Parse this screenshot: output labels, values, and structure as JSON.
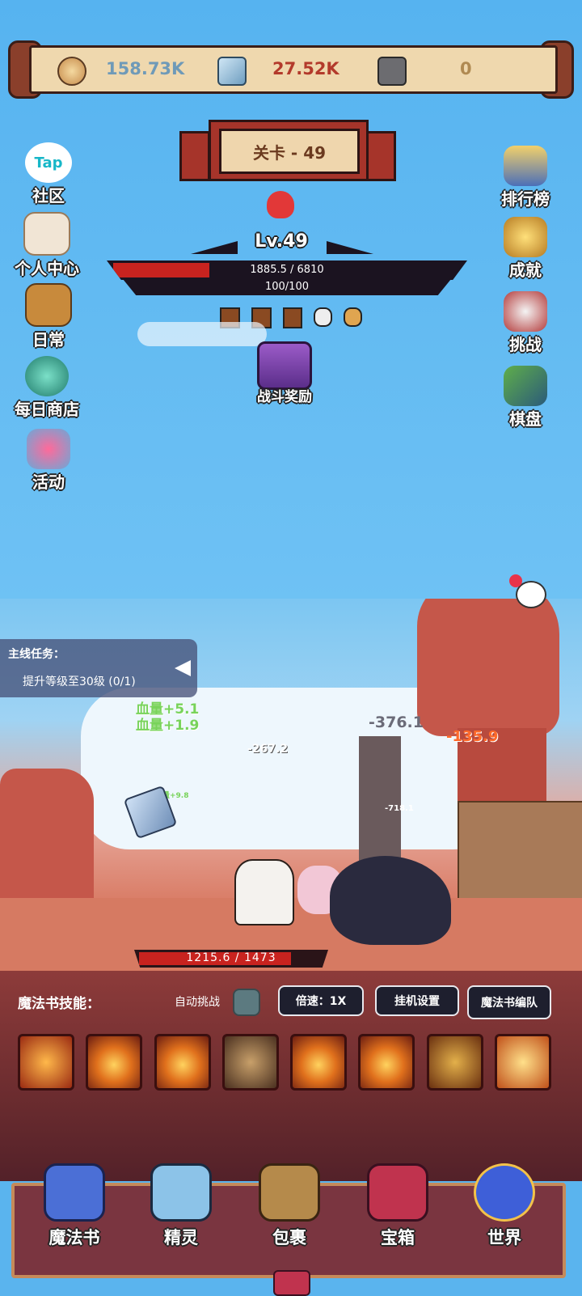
{
  "resources": {
    "gold": "158.73K",
    "crystal": "27.52K",
    "rune": "0"
  },
  "stage": {
    "label": "关卡 - 49"
  },
  "left_menu": [
    {
      "label": "社区",
      "icon": "tap-community-icon",
      "badge": "Tap"
    },
    {
      "label": "个人中心",
      "icon": "scroll-profile-icon"
    },
    {
      "label": "日常",
      "icon": "bucket-daily-icon"
    },
    {
      "label": "每日商店",
      "icon": "crystal-ball-shop-icon"
    },
    {
      "label": "活动",
      "icon": "potion-event-icon"
    }
  ],
  "right_menu": [
    {
      "label": "排行榜",
      "icon": "sword-ranking-icon"
    },
    {
      "label": "成就",
      "icon": "trophy-icon"
    },
    {
      "label": "挑战",
      "icon": "skull-challenge-icon"
    },
    {
      "label": "棋盘",
      "icon": "board-icon"
    }
  ],
  "boss": {
    "level": "Lv.49",
    "hp_text": "1885.5 / 6810",
    "hp_fraction": 0.277,
    "shield_text": "100/100",
    "shield_fraction": 1.0
  },
  "battle_reward": {
    "label": "战斗奖励"
  },
  "quest": {
    "title": "主线任务：",
    "task": "提升等级至30级  (0/1)"
  },
  "floating_text": {
    "heal1": "血量+5.1",
    "heal2": "血量+1.9",
    "dmg1": "-376.1",
    "dmg2": "-135.9",
    "dmg3": "-267.2",
    "dmg4": "-718.1",
    "heal_small": "血量+9.8"
  },
  "player": {
    "hp_text": "1215.6 / 1473",
    "hp_fraction": 0.825
  },
  "controls": {
    "skills_label": "魔法书技能：",
    "auto_label": "自动挑战",
    "speed": "倍速：1X",
    "idle": "挂机设置",
    "team": "魔法书编队"
  },
  "bottom_nav": [
    {
      "label": "魔法书",
      "icon": "magic-book-icon",
      "color": "#4b6fd6"
    },
    {
      "label": "精灵",
      "icon": "spirit-crystal-icon",
      "color": "#8cc3e8"
    },
    {
      "label": "包裹",
      "icon": "backpack-icon",
      "color": "#b58a4b"
    },
    {
      "label": "宝箱",
      "icon": "treasure-chest-icon",
      "color": "#c0334e"
    },
    {
      "label": "世界",
      "icon": "world-eye-icon",
      "color": "#3e5fd8"
    }
  ],
  "colors": {
    "hp_red": "#c8231f",
    "gold_text": "#6f9ab8",
    "crystal_text": "#b33a2b",
    "rune_text": "#b08a52"
  }
}
